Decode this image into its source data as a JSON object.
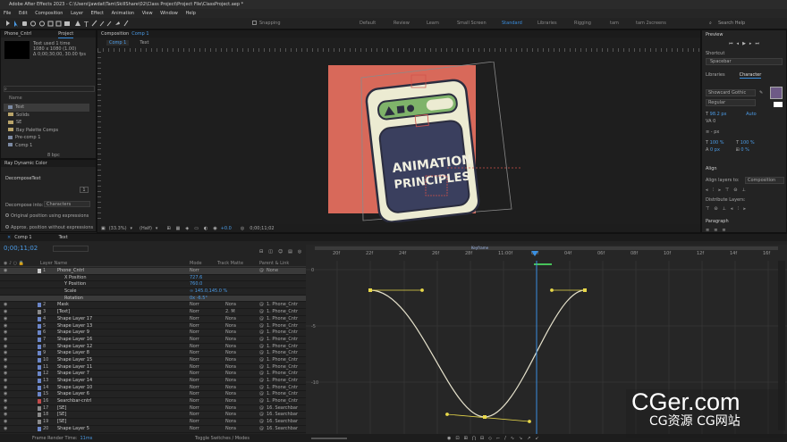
{
  "app": {
    "title": "Adobe After Effects 2023 - C:\\Users\\Jawdat\\Tam\\SkillShare\\02\\Class Project\\Project File\\ClassProject.aep *"
  },
  "menu": [
    "File",
    "Edit",
    "Composition",
    "Layer",
    "Effect",
    "Animation",
    "View",
    "Window",
    "Help"
  ],
  "toolbar": {
    "snapping": "Snapping",
    "workspaces": [
      "Default",
      "Review",
      "Learn",
      "Small Screen",
      "Standard",
      "Libraries",
      "Rigging",
      "tam",
      "tam 2screens"
    ],
    "active_workspace": "Standard",
    "search_help": "Search Help"
  },
  "project": {
    "tab_left": "Phone_Cntrl",
    "tab_project": "Project",
    "selected_name": "Text",
    "used": "used 1 time",
    "size": "1080 x 1080 (1.00)",
    "duration": "Δ 0;00;30;00, 30.00 fps",
    "col_name": "Name",
    "items": [
      {
        "name": "Text",
        "type": "comp"
      },
      {
        "name": "Solids",
        "type": "folder"
      },
      {
        "name": "SE",
        "type": "folder"
      },
      {
        "name": "Bay Palette Comps",
        "type": "folder"
      },
      {
        "name": "Pre-comp 1",
        "type": "comp"
      },
      {
        "name": "Comp 1",
        "type": "comp"
      }
    ],
    "bpc": "8 bpc"
  },
  "effects": {
    "title": "Ray Dynamic Color",
    "effect": "DecomposeText",
    "decompose_label": "Decompose into:",
    "decompose_value": "Characters",
    "value_box": "1",
    "opt1": "Original position using expressions",
    "opt2": "Approx. position without expressions"
  },
  "composition": {
    "panel": "Composition",
    "comp_name": "Comp 1",
    "crumb_comp": "Comp 1",
    "crumb_text": "Text",
    "art_text_1": "ANIMATION",
    "art_text_2": "PRINCIPLES",
    "zoom": "(33.3%)",
    "resolution": "(Half)",
    "exposure": "+0.0",
    "timecode": "0;00;11;02"
  },
  "timeline": {
    "tab1": "Comp 1",
    "tab2": "Text",
    "current_time": "0;00;11;02",
    "col_layer": "Layer Name",
    "col_mode": "Mode",
    "col_trkmat": "Track Matte",
    "col_parent": "Parent & Link",
    "footer_render": "Frame Render Time:",
    "footer_render_val": "11ms",
    "footer_toggle": "Toggle Switches / Modes",
    "ruler": [
      "20f",
      "22f",
      "24f",
      "26f",
      "28f",
      "11:00f",
      "02f",
      "04f",
      "06f",
      "08f",
      "10f",
      "12f",
      "14f",
      "16f"
    ],
    "work_label": "Keyframe",
    "graph_labels": [
      "0",
      "-5",
      "-10"
    ],
    "layers": [
      {
        "num": "1",
        "name": "Phone_Cntrl",
        "mode": "Norr",
        "trk": "",
        "parent": "None",
        "color": "#c9c9c9",
        "sel": true,
        "indent": 0
      },
      {
        "num": "",
        "name": "X Position",
        "mode": "727.6",
        "trk": "",
        "parent": "",
        "color": "",
        "sel": false,
        "indent": 1,
        "prop": true
      },
      {
        "num": "",
        "name": "Y Position",
        "mode": "760.0",
        "trk": "",
        "parent": "",
        "color": "",
        "sel": false,
        "indent": 1,
        "prop": true
      },
      {
        "num": "",
        "name": "Scale",
        "mode": "∞ 145.0,145.0 %",
        "trk": "",
        "parent": "",
        "color": "",
        "sel": false,
        "indent": 1,
        "prop": true
      },
      {
        "num": "",
        "name": "Rotation",
        "mode": "0x -6.5°",
        "trk": "",
        "parent": "",
        "color": "",
        "sel": true,
        "indent": 1,
        "prop": true
      },
      {
        "num": "2",
        "name": "Mask",
        "mode": "Norr",
        "trk": "Nora",
        "parent": "1. Phone_Cntr",
        "color": "#6b86c9"
      },
      {
        "num": "3",
        "name": "[Text]",
        "mode": "Norr",
        "trk": "2. M",
        "parent": "1. Phone_Cntr",
        "color": "#8a8a8a"
      },
      {
        "num": "4",
        "name": "Shape Layer 17",
        "mode": "Norr",
        "trk": "Nora",
        "parent": "1. Phone_Cntr",
        "color": "#6b86c9"
      },
      {
        "num": "5",
        "name": "Shape Layer 13",
        "mode": "Norr",
        "trk": "Nora",
        "parent": "1. Phone_Cntr",
        "color": "#6b86c9"
      },
      {
        "num": "6",
        "name": "Shape Layer 9",
        "mode": "Norr",
        "trk": "Nora",
        "parent": "1. Phone_Cntr",
        "color": "#6b86c9"
      },
      {
        "num": "7",
        "name": "Shape Layer 16",
        "mode": "Norr",
        "trk": "Nora",
        "parent": "1. Phone_Cntr",
        "color": "#6b86c9"
      },
      {
        "num": "8",
        "name": "Shape Layer 12",
        "mode": "Norr",
        "trk": "Nora",
        "parent": "1. Phone_Cntr",
        "color": "#6b86c9"
      },
      {
        "num": "9",
        "name": "Shape Layer 8",
        "mode": "Norr",
        "trk": "Nora",
        "parent": "1. Phone_Cntr",
        "color": "#6b86c9"
      },
      {
        "num": "10",
        "name": "Shape Layer 15",
        "mode": "Norr",
        "trk": "Nora",
        "parent": "1. Phone_Cntr",
        "color": "#6b86c9"
      },
      {
        "num": "11",
        "name": "Shape Layer 11",
        "mode": "Norr",
        "trk": "Nora",
        "parent": "1. Phone_Cntr",
        "color": "#6b86c9"
      },
      {
        "num": "12",
        "name": "Shape Layer 7",
        "mode": "Norr",
        "trk": "Nora",
        "parent": "1. Phone_Cntr",
        "color": "#6b86c9"
      },
      {
        "num": "13",
        "name": "Shape Layer 14",
        "mode": "Norr",
        "trk": "Nora",
        "parent": "1. Phone_Cntr",
        "color": "#6b86c9"
      },
      {
        "num": "14",
        "name": "Shape Layer 10",
        "mode": "Norr",
        "trk": "Nora",
        "parent": "1. Phone_Cntr",
        "color": "#6b86c9"
      },
      {
        "num": "15",
        "name": "Shape Layer 6",
        "mode": "Norr",
        "trk": "Nora",
        "parent": "1. Phone_Cntr",
        "color": "#6b86c9"
      },
      {
        "num": "16",
        "name": "Searchbar-cntrl",
        "mode": "Norr",
        "trk": "Nora",
        "parent": "1. Phone_Cntr",
        "color": "#c24a4a"
      },
      {
        "num": "17",
        "name": "[SE]",
        "mode": "Norr",
        "trk": "Nora",
        "parent": "16. Searchbar",
        "color": "#8a8a8a"
      },
      {
        "num": "18",
        "name": "[SE]",
        "mode": "Norr",
        "trk": "Nora",
        "parent": "16. Searchbar",
        "color": "#8a8a8a"
      },
      {
        "num": "19",
        "name": "[SE]",
        "mode": "Norr",
        "trk": "Nora",
        "parent": "16. Searchbar",
        "color": "#8a8a8a"
      },
      {
        "num": "20",
        "name": "Shape Layer 5",
        "mode": "Norr",
        "trk": "Nora",
        "parent": "16. Searchbar",
        "color": "#6b86c9"
      }
    ]
  },
  "right": {
    "preview": "Preview",
    "shortcut": "Shortcut",
    "shortcut_val": "Spacebar",
    "libraries": "Libraries",
    "character": "Character",
    "font": "Showcard Gothic",
    "style": "Regular",
    "size": "98.2 px",
    "leading": "Auto",
    "tracking": "0",
    "px": "- px",
    "vscale": "100 %",
    "hscale": "100 %",
    "baseline": "0 px",
    "tsume": "0 %",
    "align": "Align",
    "align_to": "Align layers to:",
    "align_to_val": "Composition",
    "distribute": "Distribute Layers:",
    "paragraph": "Paragraph",
    "swatch_color": "#6e5a86"
  },
  "watermark": {
    "line1": "CGer.com",
    "line2": "CG资源  CG网站"
  },
  "colors": {
    "canvas_bg": "#d8695a",
    "phone_body": "#ecebd2",
    "phone_screen": "#3a3f5e",
    "accent_blue": "#3a8fe0",
    "curve_yellow": "#e8d84a"
  }
}
